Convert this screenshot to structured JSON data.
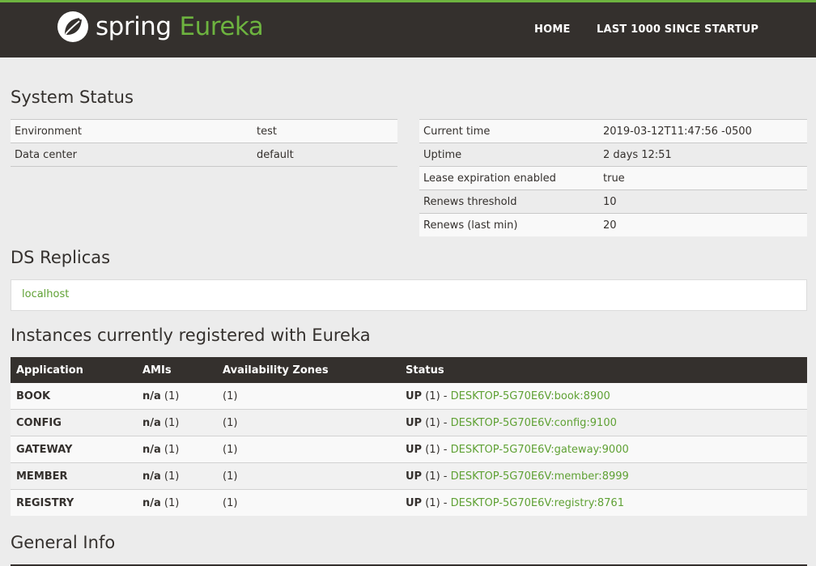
{
  "brand": {
    "spring": "spring",
    "eureka": "Eureka"
  },
  "nav": {
    "home": "HOME",
    "last1000": "LAST 1000 SINCE STARTUP"
  },
  "system_status": {
    "title": "System Status",
    "left": [
      {
        "label": "Environment",
        "value": "test"
      },
      {
        "label": "Data center",
        "value": "default"
      }
    ],
    "right": [
      {
        "label": "Current time",
        "value": "2019-03-12T11:47:56 -0500"
      },
      {
        "label": "Uptime",
        "value": "2 days 12:51"
      },
      {
        "label": "Lease expiration enabled",
        "value": "true"
      },
      {
        "label": "Renews threshold",
        "value": "10"
      },
      {
        "label": "Renews (last min)",
        "value": "20"
      }
    ]
  },
  "ds_replicas": {
    "title": "DS Replicas",
    "items": [
      "localhost"
    ]
  },
  "instances": {
    "title": "Instances currently registered with Eureka",
    "columns": [
      "Application",
      "AMIs",
      "Availability Zones",
      "Status"
    ],
    "rows": [
      {
        "app": "BOOK",
        "ami_bold": "n/a",
        "ami_count": "(1)",
        "zones": "(1)",
        "status": "UP",
        "status_count": "(1) -",
        "instance": "DESKTOP-5G70E6V:book:8900"
      },
      {
        "app": "CONFIG",
        "ami_bold": "n/a",
        "ami_count": "(1)",
        "zones": "(1)",
        "status": "UP",
        "status_count": "(1) -",
        "instance": "DESKTOP-5G70E6V:config:9100"
      },
      {
        "app": "GATEWAY",
        "ami_bold": "n/a",
        "ami_count": "(1)",
        "zones": "(1)",
        "status": "UP",
        "status_count": "(1) -",
        "instance": "DESKTOP-5G70E6V:gateway:9000"
      },
      {
        "app": "MEMBER",
        "ami_bold": "n/a",
        "ami_count": "(1)",
        "zones": "(1)",
        "status": "UP",
        "status_count": "(1) -",
        "instance": "DESKTOP-5G70E6V:member:8999"
      },
      {
        "app": "REGISTRY",
        "ami_bold": "n/a",
        "ami_count": "(1)",
        "zones": "(1)",
        "status": "UP",
        "status_count": "(1) -",
        "instance": "DESKTOP-5G70E6V:registry:8761"
      }
    ]
  },
  "general_info": {
    "title": "General Info"
  },
  "colors": {
    "accent": "#6db33f",
    "header_bg": "#34302d",
    "link": "#5fa134"
  },
  "icons": {
    "logo": "spring-leaf-icon"
  }
}
